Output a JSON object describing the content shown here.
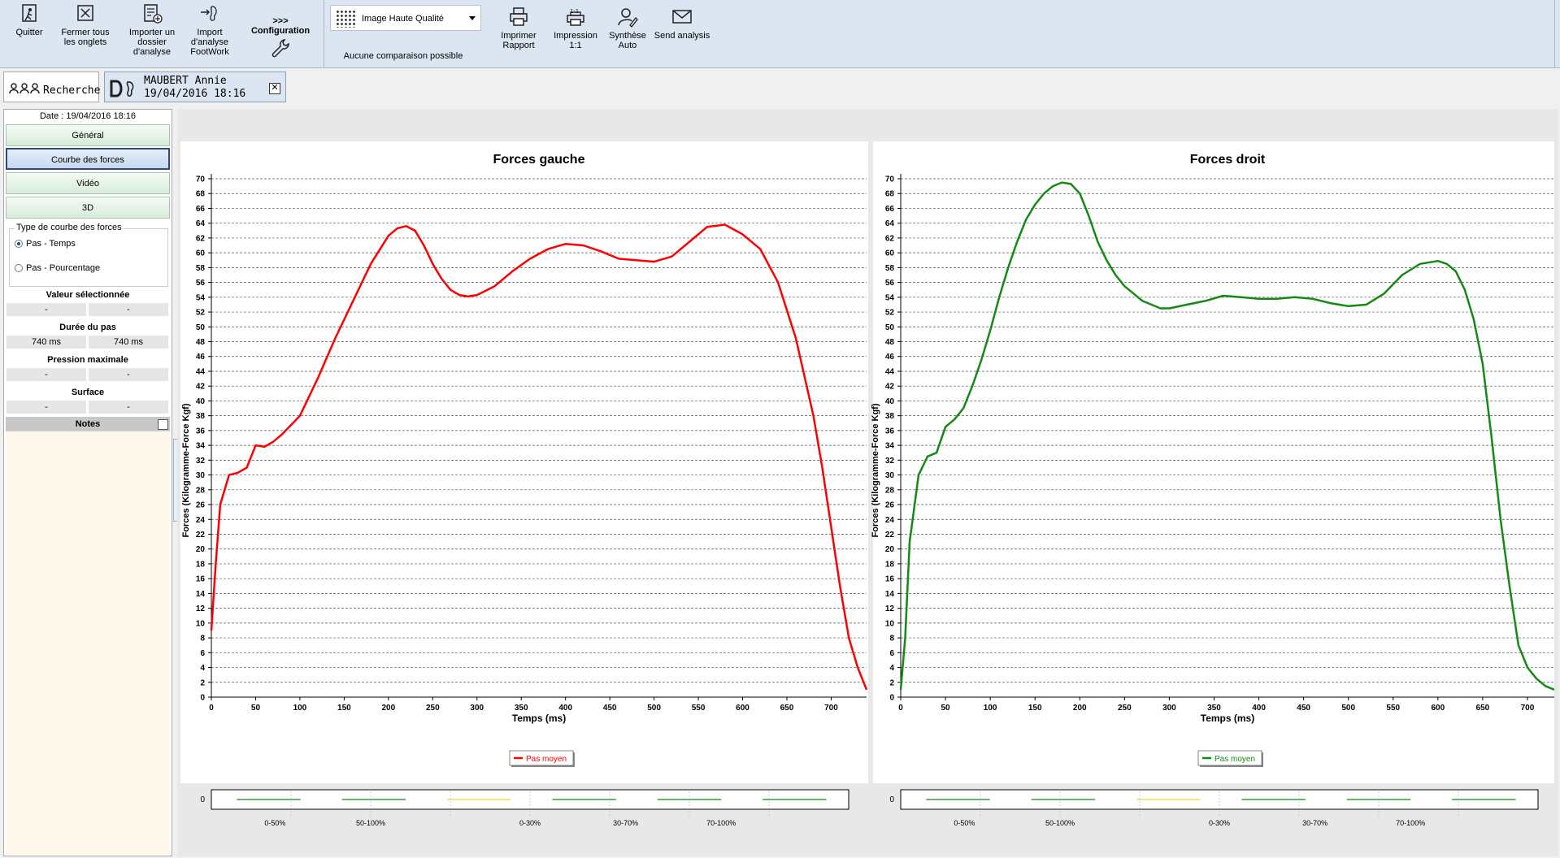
{
  "toolbar": {
    "quit": "Quitter",
    "close_tabs_1": "Fermer tous",
    "close_tabs_2": "les onglets",
    "import_folder_1": "Importer un",
    "import_folder_2": "dossier",
    "import_folder_3": "d'analyse",
    "import_fw_1": "Import",
    "import_fw_2": "d'analyse",
    "import_fw_3": "FootWork",
    "config_arrows": ">>>",
    "config": "Configuration",
    "quality": "Image Haute Qualité",
    "no_compare": "Aucune comparaison possible",
    "print_1": "Imprimer",
    "print_2": "Rapport",
    "print11_1": "Impression",
    "print11_2": "1:1",
    "synth_1": "Synthèse",
    "synth_2": "Auto",
    "send": "Send analysis"
  },
  "tabs": {
    "search": "Recherche",
    "patient_name": "MAUBERT Annie",
    "patient_date": "19/04/2016 18:16",
    "close": "✕"
  },
  "sidebar": {
    "date": "Date : 19/04/2016 18:16",
    "nav": [
      "Général",
      "Courbe des forces",
      "Vidéo",
      "3D"
    ],
    "active_index": 1,
    "curve_type_legend": "Type de courbe des forces",
    "radio_time": "Pas - Temps",
    "radio_percent": "Pas - Pourcentage",
    "selected_value_title": "Valeur sélectionnée",
    "selected_value": [
      "-",
      "-"
    ],
    "step_duration_title": "Durée du pas",
    "step_duration": [
      "740 ms",
      "740 ms"
    ],
    "max_pressure_title": "Pression maximale",
    "max_pressure": [
      "-",
      "-"
    ],
    "surface_title": "Surface",
    "surface": [
      "-",
      "-"
    ],
    "notes": "Notes"
  },
  "colors": {
    "left": "#ff0000",
    "right": "#148a14"
  },
  "chart_data": [
    {
      "type": "line",
      "title": "Forces gauche",
      "xlabel": "Temps (ms)",
      "ylabel": "Forces (Kilogramme-Force Kgf)",
      "xlim": [
        0,
        740
      ],
      "ylim": [
        0,
        70
      ],
      "xticks": [
        0,
        50,
        100,
        150,
        200,
        250,
        300,
        350,
        400,
        450,
        500,
        550,
        600,
        650,
        700
      ],
      "ytick_step": 2,
      "grid": true,
      "legend": "bottom-center",
      "series": [
        {
          "name": "Pas moyen",
          "x": [
            0,
            5,
            10,
            20,
            30,
            40,
            50,
            60,
            70,
            80,
            100,
            120,
            140,
            160,
            180,
            200,
            210,
            220,
            230,
            240,
            250,
            260,
            270,
            280,
            290,
            300,
            320,
            340,
            360,
            380,
            400,
            420,
            440,
            460,
            480,
            500,
            520,
            540,
            560,
            580,
            600,
            620,
            640,
            660,
            680,
            690,
            700,
            710,
            720,
            730,
            740
          ],
          "y": [
            9,
            18,
            26,
            30,
            30.3,
            31,
            34,
            33.8,
            34.5,
            35.5,
            38,
            43,
            48.5,
            53.5,
            58.5,
            62.3,
            63.3,
            63.6,
            63,
            61,
            58.5,
            56.5,
            55,
            54.3,
            54.1,
            54.3,
            55.5,
            57.5,
            59.2,
            60.5,
            61.2,
            61,
            60.2,
            59.2,
            59,
            58.8,
            59.5,
            61.5,
            63.5,
            63.8,
            62.5,
            60.5,
            56,
            48.5,
            38,
            31,
            23,
            15,
            8,
            4,
            1
          ]
        }
      ]
    },
    {
      "type": "line",
      "title": "Forces droit",
      "xlabel": "Temps (ms)",
      "ylabel": "Forces (Kilogramme-Force Kgf)",
      "xlim": [
        0,
        730
      ],
      "ylim": [
        0,
        70
      ],
      "xticks": [
        0,
        50,
        100,
        150,
        200,
        250,
        300,
        350,
        400,
        450,
        500,
        550,
        600,
        650,
        700
      ],
      "ytick_step": 2,
      "grid": true,
      "legend": "bottom-center",
      "series": [
        {
          "name": "Pas moyen",
          "x": [
            0,
            5,
            10,
            20,
            30,
            40,
            50,
            60,
            70,
            80,
            90,
            100,
            110,
            120,
            130,
            140,
            150,
            160,
            170,
            180,
            190,
            200,
            210,
            220,
            230,
            240,
            250,
            260,
            270,
            280,
            290,
            300,
            320,
            340,
            360,
            380,
            400,
            420,
            440,
            460,
            480,
            500,
            520,
            540,
            560,
            580,
            600,
            610,
            620,
            630,
            640,
            650,
            660,
            670,
            680,
            690,
            700,
            710,
            720,
            730
          ],
          "y": [
            1,
            8,
            21,
            30,
            32.5,
            33,
            36.5,
            37.5,
            39,
            42,
            45.5,
            49.5,
            54,
            58,
            61.5,
            64.5,
            66.5,
            68,
            69,
            69.5,
            69.3,
            68,
            65,
            61.5,
            59,
            57,
            55.5,
            54.5,
            53.5,
            53,
            52.5,
            52.5,
            53,
            53.5,
            54.2,
            54,
            53.8,
            53.8,
            54,
            53.8,
            53.2,
            52.8,
            53,
            54.5,
            57,
            58.5,
            58.9,
            58.5,
            57.5,
            55,
            51,
            45,
            35,
            24,
            15,
            7,
            4,
            2.5,
            1.5,
            1
          ]
        }
      ]
    }
  ],
  "bottom_strip": {
    "zero": "0",
    "labels": [
      "0-50%",
      "50-100%",
      "0-30%",
      "30-70%",
      "70-100%"
    ]
  }
}
